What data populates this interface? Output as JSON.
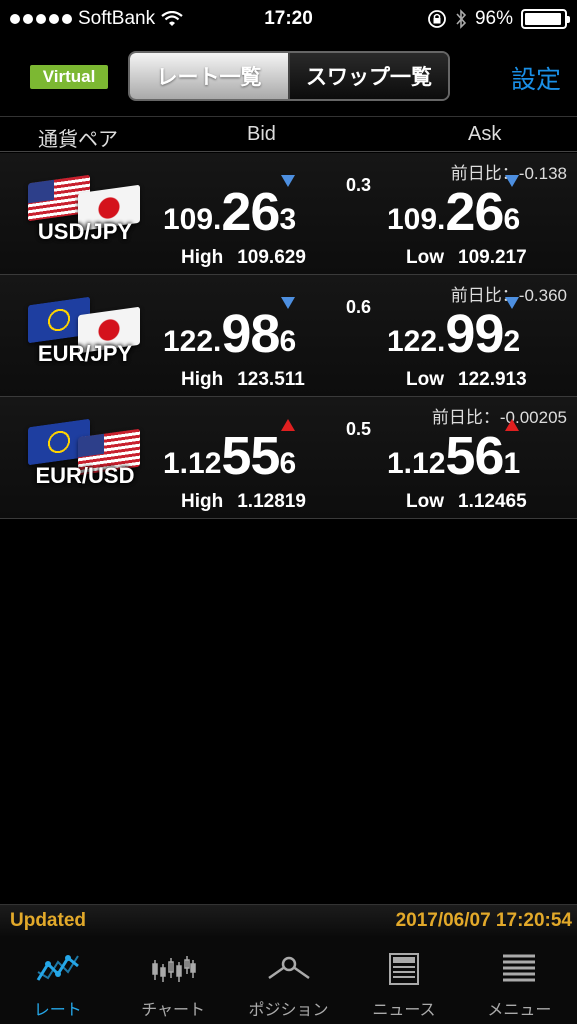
{
  "status_bar": {
    "carrier": "SoftBank",
    "time": "17:20",
    "battery": "96%"
  },
  "navbar": {
    "virtual_label": "Virtual",
    "segments": [
      "レート一覧",
      "スワップ一覧"
    ],
    "active_segment": 0,
    "settings_label": "設定"
  },
  "table_header": {
    "pair": "通貨ペア",
    "bid": "Bid",
    "ask": "Ask"
  },
  "rows": [
    {
      "pair": "USD/JPY",
      "flags": [
        "us",
        "jp"
      ],
      "change_label": "前日比：",
      "change_value": "-0.138",
      "spread": "0.3",
      "bid": {
        "prefix": "109.",
        "big": "26",
        "last": "3",
        "direction": "down"
      },
      "ask": {
        "prefix": "109.",
        "big": "26",
        "last": "6",
        "direction": "down"
      },
      "high_label": "High",
      "high": "109.629",
      "low_label": "Low",
      "low": "109.217"
    },
    {
      "pair": "EUR/JPY",
      "flags": [
        "eu",
        "jp"
      ],
      "change_label": "前日比：",
      "change_value": "-0.360",
      "spread": "0.6",
      "bid": {
        "prefix": "122.",
        "big": "98",
        "last": "6",
        "direction": "down"
      },
      "ask": {
        "prefix": "122.",
        "big": "99",
        "last": "2",
        "direction": "down"
      },
      "high_label": "High",
      "high": "123.511",
      "low_label": "Low",
      "low": "122.913"
    },
    {
      "pair": "EUR/USD",
      "flags": [
        "eu",
        "us"
      ],
      "change_label": "前日比：",
      "change_value": "-0.00205",
      "spread": "0.5",
      "bid": {
        "prefix": "1.12",
        "big": "55",
        "last": "6",
        "direction": "up"
      },
      "ask": {
        "prefix": "1.12",
        "big": "56",
        "last": "1",
        "direction": "up"
      },
      "high_label": "High",
      "high": "1.12819",
      "low_label": "Low",
      "low": "1.12465"
    }
  ],
  "updated": {
    "label": "Updated",
    "timestamp": "2017/06/07 17:20:54"
  },
  "tabs": [
    {
      "label": "レート",
      "icon": "rate-line-icon",
      "active": true
    },
    {
      "label": "チャート",
      "icon": "candlestick-icon",
      "active": false
    },
    {
      "label": "ポジション",
      "icon": "position-icon",
      "active": false
    },
    {
      "label": "ニュース",
      "icon": "news-icon",
      "active": false
    },
    {
      "label": "メニュー",
      "icon": "menu-list-icon",
      "active": false
    }
  ],
  "colors": {
    "accent_blue": "#1a8fe6",
    "virtual_green": "#7cb832",
    "updated_gold": "#e2a92a",
    "arrow_down": "#4d8fe0",
    "arrow_up": "#e02020"
  }
}
